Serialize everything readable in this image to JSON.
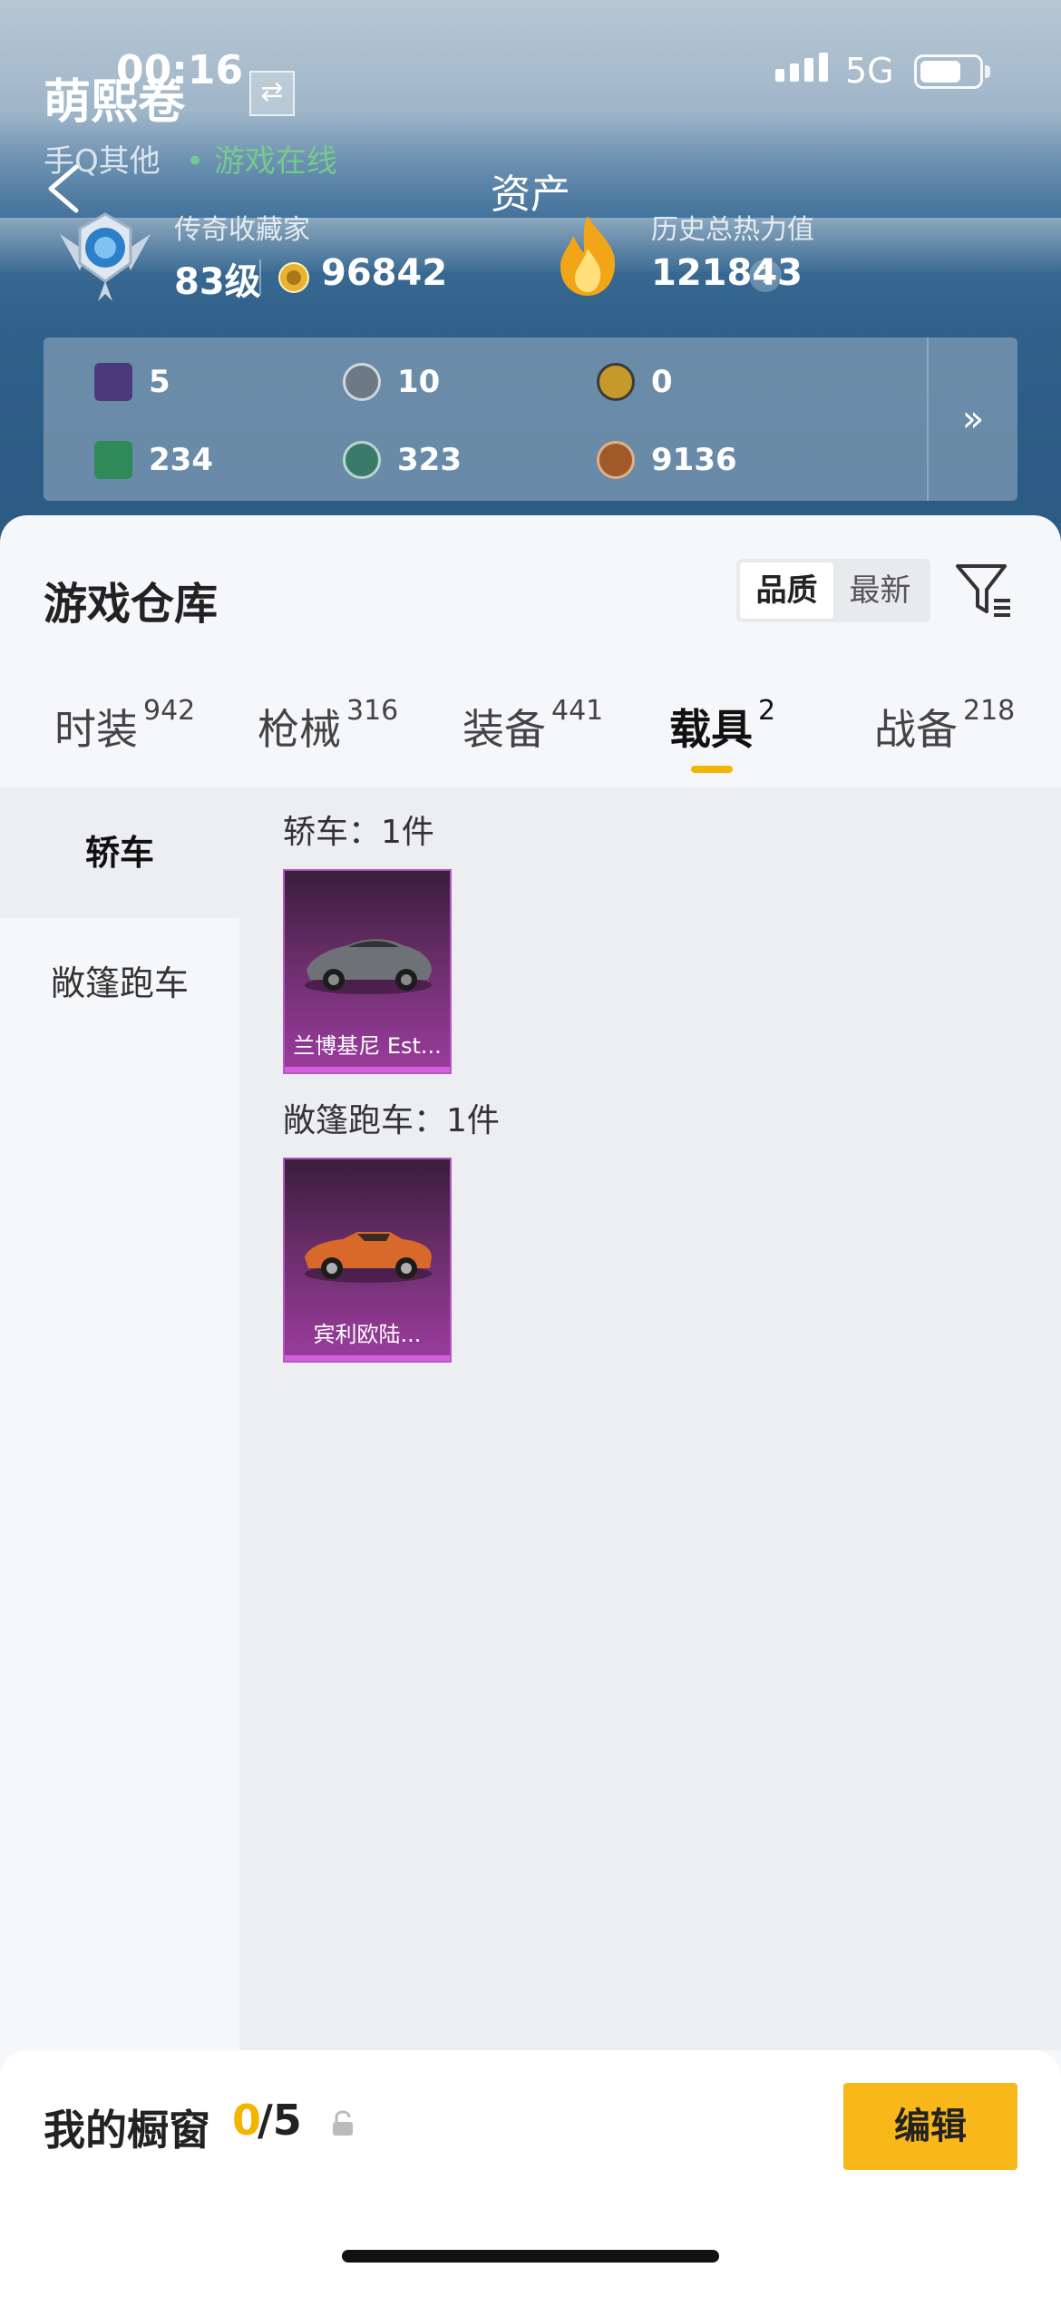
{
  "status_bar": {
    "time": "00:16",
    "network": "5G"
  },
  "profile": {
    "username": "萌熙卷",
    "platform": "手Q其他",
    "online_status": "• 游戏在线"
  },
  "header": {
    "title": "资产"
  },
  "collector": {
    "title": "传奇收藏家",
    "level": "83级",
    "coins": "96842"
  },
  "heat": {
    "title": "历史总热力值",
    "value": "121843",
    "help": "?"
  },
  "currencies": [
    {
      "icon": "purple-card-icon",
      "value": "5",
      "color": "#4b3a7a"
    },
    {
      "icon": "silver-coin-icon",
      "value": "10",
      "color": "#6d7a86"
    },
    {
      "icon": "gold-coin-icon",
      "value": "0",
      "color": "#c59a2a"
    },
    {
      "icon": "green-card-icon",
      "value": "234",
      "color": "#2f8a5a"
    },
    {
      "icon": "green-gem-icon",
      "value": "323",
      "color": "#3a7a6a"
    },
    {
      "icon": "bronze-coin-icon",
      "value": "9136",
      "color": "#a05a2a"
    }
  ],
  "currency_more": "»",
  "warehouse": {
    "title": "游戏仓库",
    "sort_options": [
      "品质",
      "最新"
    ],
    "tabs": [
      {
        "label": "时装",
        "count": "942"
      },
      {
        "label": "枪械",
        "count": "316"
      },
      {
        "label": "装备",
        "count": "441"
      },
      {
        "label": "载具",
        "count": "2"
      },
      {
        "label": "战备",
        "count": "218"
      }
    ],
    "active_tab": "载具",
    "categories": [
      "轿车",
      "敞篷跑车"
    ],
    "groups": [
      {
        "title": "轿车：1件",
        "items": [
          {
            "name": "兰博基尼 Est..."
          }
        ]
      },
      {
        "title": "敞篷跑车：1件",
        "items": [
          {
            "name": "宾利欧陆..."
          }
        ]
      }
    ]
  },
  "showcase": {
    "label": "我的橱窗",
    "count": "0",
    "total": "/5",
    "edit_label": "编辑"
  },
  "colors": {
    "accent": "#f9b81a",
    "card_purple": "#9b3c9e"
  }
}
